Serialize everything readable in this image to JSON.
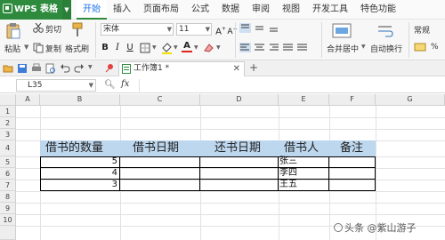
{
  "app": {
    "title": "WPS 表格"
  },
  "menu": {
    "tabs": [
      "开始",
      "插入",
      "页面布局",
      "公式",
      "数据",
      "审阅",
      "视图",
      "开发工具",
      "特色功能"
    ],
    "active_index": 0
  },
  "ribbon": {
    "paste": "粘贴",
    "cut": "剪切",
    "copy": "复制",
    "format_painter": "格式刷",
    "font_name": "宋体",
    "font_size": "11",
    "merge_center": "合并居中",
    "wrap_text": "自动换行",
    "number_format": "常规"
  },
  "document": {
    "tab_title": "工作簿1 *"
  },
  "formula_bar": {
    "name_box": "L35",
    "fx": "fx",
    "formula": ""
  },
  "grid": {
    "columns": [
      "A",
      "B",
      "C",
      "D",
      "E",
      "F",
      "G"
    ],
    "rows": [
      "1",
      "2",
      "3",
      "4",
      "5",
      "6",
      "7",
      "8",
      "9",
      "10"
    ]
  },
  "table": {
    "headers": [
      "借书的数量",
      "借书日期",
      "还书日期",
      "借书人",
      "备注"
    ],
    "rows": [
      {
        "qty": "5",
        "borrow_date": "",
        "return_date": "",
        "borrower": "张三",
        "note": ""
      },
      {
        "qty": "4",
        "borrow_date": "",
        "return_date": "",
        "borrower": "李四",
        "note": ""
      },
      {
        "qty": "3",
        "borrow_date": "",
        "return_date": "",
        "borrower": "王五",
        "note": ""
      }
    ]
  },
  "colors": {
    "brand": "#2e8b3e",
    "header_fill": "#bdd7ee",
    "active_tab_text": "#1a73e8"
  },
  "watermark": "头条 @紫山游子"
}
